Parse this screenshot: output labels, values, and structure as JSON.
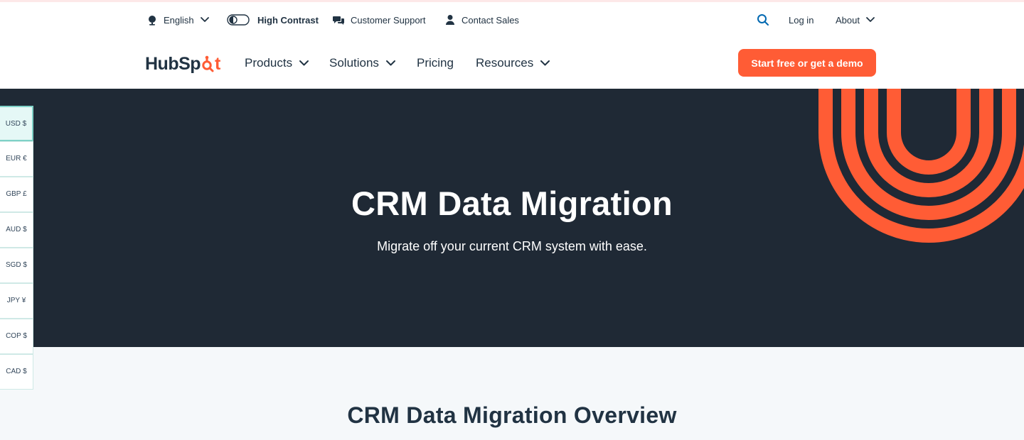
{
  "utility": {
    "language": "English",
    "high_contrast": "High Contrast",
    "support": "Customer Support",
    "contact": "Contact Sales",
    "login": "Log in",
    "about": "About"
  },
  "nav": {
    "logo_part1": "HubSp",
    "logo_part2": "t",
    "products": "Products",
    "solutions": "Solutions",
    "pricing": "Pricing",
    "resources": "Resources",
    "cta": "Start free or get a demo"
  },
  "hero": {
    "title": "CRM Data Migration",
    "subtitle": "Migrate off your current CRM system with ease."
  },
  "section": {
    "title": "CRM Data Migration Overview"
  },
  "currency": {
    "selected": "USD $",
    "options": [
      "USD $",
      "EUR €",
      "GBP £",
      "AUD $",
      "SGD $",
      "JPY ¥",
      "COP $",
      "CAD $"
    ]
  },
  "colors": {
    "accent": "#ff5c35",
    "hero_bg": "#1f2935",
    "text": "#213343",
    "teal_border": "#7fd1c7"
  }
}
